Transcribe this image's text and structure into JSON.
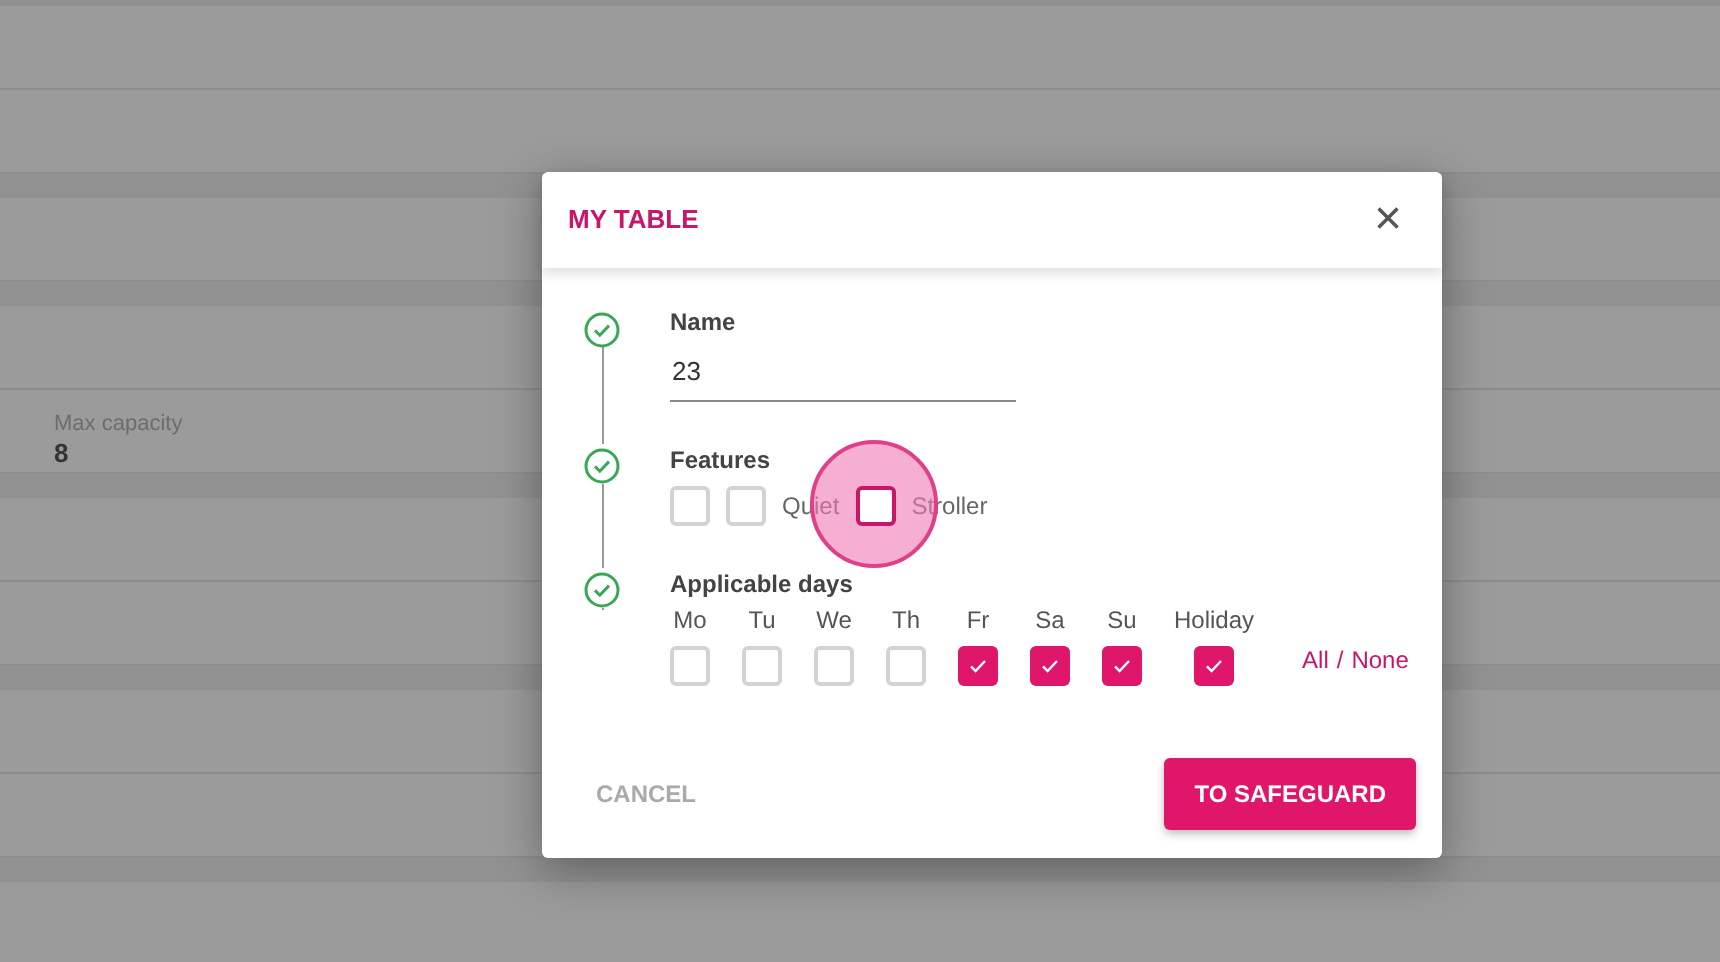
{
  "background": {
    "groups": [
      {
        "rows": [
          {},
          {}
        ]
      },
      {
        "rows": [
          {}
        ]
      },
      {
        "rows": [
          {},
          {
            "label": "Max capacity",
            "value": "8"
          }
        ]
      },
      {
        "rows": [
          {},
          {}
        ]
      },
      {
        "rows": [
          {},
          {}
        ]
      },
      {
        "rows": [
          {}
        ]
      }
    ]
  },
  "dialog": {
    "title": "MY TABLE",
    "close": "×",
    "steps": [
      {
        "kind": "text",
        "completed": true,
        "label": "Name",
        "value": "23"
      },
      {
        "kind": "features",
        "completed": true,
        "label": "Features",
        "options": [
          {
            "checked": false
          },
          {
            "checked": false,
            "label": "Quiet"
          },
          {
            "checked": false,
            "label": "Stroller",
            "focused": true
          }
        ]
      },
      {
        "kind": "days",
        "completed": true,
        "label": "Applicable days",
        "days": [
          {
            "label": "Mo",
            "checked": false
          },
          {
            "label": "Tu",
            "checked": false
          },
          {
            "label": "We",
            "checked": false
          },
          {
            "label": "Th",
            "checked": false
          },
          {
            "label": "Fr",
            "checked": true
          },
          {
            "label": "Sa",
            "checked": true
          },
          {
            "label": "Su",
            "checked": true
          },
          {
            "label": "Holiday",
            "checked": true
          }
        ],
        "all": "All",
        "separator": "/",
        "none": "None"
      }
    ],
    "cancel": "CANCEL",
    "submit": "TO SAFEGUARD"
  }
}
